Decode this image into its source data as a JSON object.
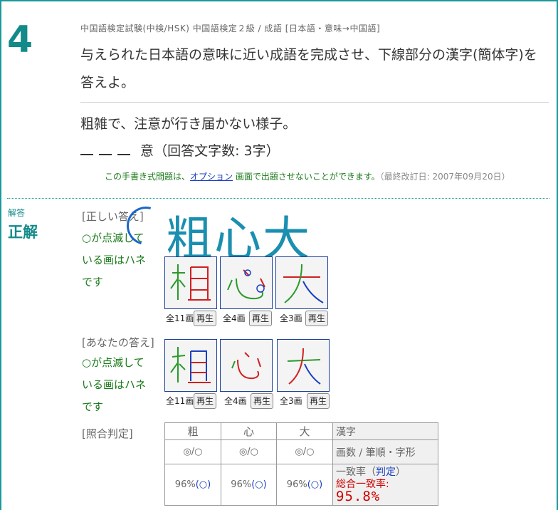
{
  "question": {
    "number": "4",
    "breadcrumb": "中国語検定試験(中検/HSK) 中国語検定２級 / 成語 [日本語・意味→中国語]",
    "instruction": "与えられた日本語の意味に近い成語を完成させ、下線部分の漢字(簡体字)を答えよ。",
    "meaning": "粗雑で、注意が行き届かない様子。",
    "tail_char": "意",
    "answer_hint": "（回答文字数: 3字）",
    "note_prefix": "この手書き式問題は、",
    "note_link": "オプション",
    "note_suffix": " 画面で出題させないことができます。",
    "note_date": "（最終改訂日: 2007年09月20日）"
  },
  "answer": {
    "label_small": "解答",
    "label_big": "正解",
    "correct_label": "[正しい答え]",
    "correct_text": "粗心大",
    "hint_lines": [
      "○が点滅して",
      "いる画はハネ",
      "です"
    ],
    "yours_label": "[あなたの答え]",
    "judge_label": "[照合判定]",
    "play_label": "再生",
    "correct_chars": [
      {
        "char": "粗",
        "strokes": "全11画"
      },
      {
        "char": "心",
        "strokes": "全4画"
      },
      {
        "char": "大",
        "strokes": "全3画"
      }
    ],
    "your_chars": [
      {
        "char": "粗",
        "strokes": "全11画"
      },
      {
        "char": "心",
        "strokes": "全4画"
      },
      {
        "char": "大",
        "strokes": "全3画"
      }
    ]
  },
  "judge_table": {
    "headers": [
      "粗",
      "心",
      "大"
    ],
    "header_label": "漢字",
    "row2": [
      "◎/○",
      "◎/○",
      "◎/○"
    ],
    "row2_label": "画数 / 筆順・字形",
    "row3_pct": [
      "96%",
      "96%",
      "96%"
    ],
    "row3_mark": "(○)",
    "row3_label_a": "一致率（",
    "row3_label_b": "判定",
    "row3_label_c": "）",
    "total_label": "総合一致率:",
    "total_value": "95.8%"
  },
  "colors": {
    "accent": "#138a8a",
    "link": "#1a3fbf",
    "hint": "#1a7a1a",
    "total": "#cc0000"
  }
}
